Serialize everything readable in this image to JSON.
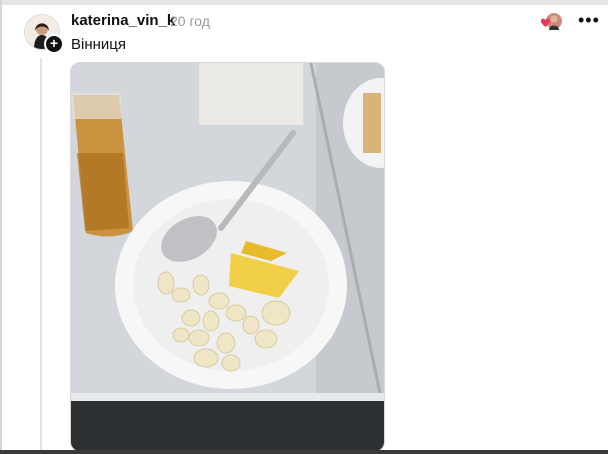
{
  "post": {
    "username": "katerina_vin_k",
    "time": "20 год",
    "location": "Вінниця"
  },
  "icons": {
    "follow": "plus-icon",
    "more": "more-icon",
    "like_avatar": "liked-avatar-icon"
  },
  "colors": {
    "heart": "#e8365d",
    "text": "#111111",
    "muted": "#999999"
  }
}
